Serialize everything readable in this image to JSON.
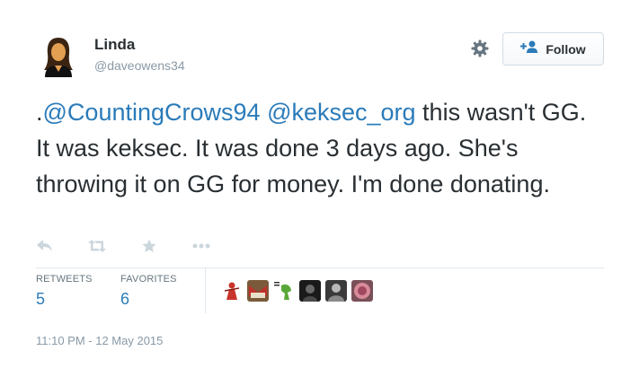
{
  "user": {
    "name": "Linda",
    "handle": "@daveowens34"
  },
  "follow_button": {
    "label": "Follow"
  },
  "tweet": {
    "prefix": ".",
    "mention1": "@CountingCrows94",
    "space": " ",
    "mention2": "@keksec_org",
    "body": " this wasn't GG.  It was keksec.  It was done 3 days ago. She's throwing it on GG for money. I'm done donating."
  },
  "actions": [
    "reply-icon",
    "retweet-icon",
    "favorite-icon",
    "more-icon"
  ],
  "stats": {
    "retweets_label": "RETWEETS",
    "retweets_value": "5",
    "favorites_label": "FAVORITES",
    "favorites_value": "6"
  },
  "favorited_by_avatars": [
    "avatar-1",
    "avatar-2",
    "avatar-3",
    "avatar-4",
    "avatar-5",
    "avatar-6"
  ],
  "timestamp": "11:10 PM - 12 May 2015",
  "colors": {
    "link": "#2b7bb9",
    "text": "#292f33",
    "muted": "#8899a6",
    "action_icon": "#ccd6dd"
  }
}
